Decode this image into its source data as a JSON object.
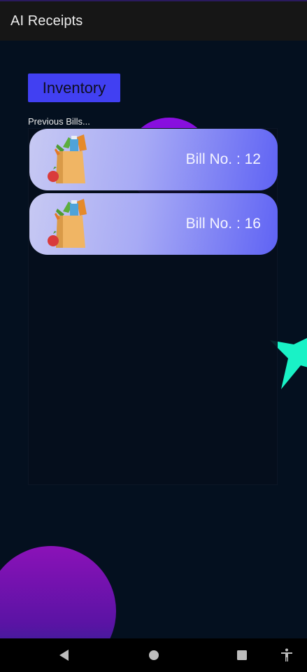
{
  "app_bar": {
    "title": "AI Receipts"
  },
  "inventory_button": {
    "label": "Inventory"
  },
  "bills_section": {
    "label": "Previous Bills...",
    "bills": [
      {
        "label": "Bill No. : 12",
        "icon": "grocery-bag-icon"
      },
      {
        "label": "Bill No. : 16",
        "icon": "grocery-bag-icon"
      }
    ]
  },
  "colors": {
    "app_bar": "#161616",
    "background": "#04101f",
    "button": "#4140f2",
    "card_start": "#c7c9f3",
    "card_end": "#5f63f4",
    "accent_star": "#19f2c6",
    "blob": "#8a0fe0"
  },
  "nav_bar": {
    "items": [
      "back-icon",
      "home-icon",
      "recents-icon",
      "accessibility-icon"
    ]
  }
}
